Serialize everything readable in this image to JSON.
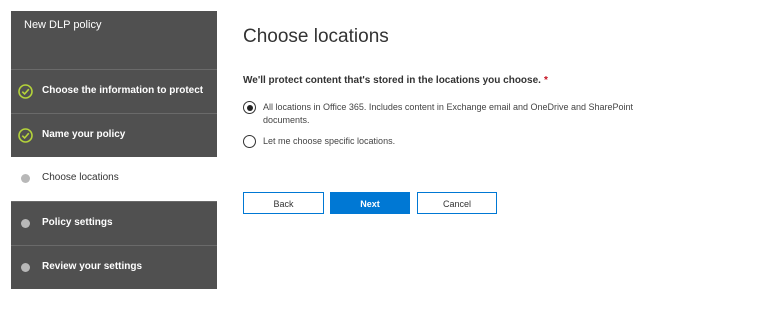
{
  "wizard": {
    "title": "New DLP policy",
    "steps": [
      {
        "label": "Choose the information to protect",
        "state": "completed"
      },
      {
        "label": "Name your policy",
        "state": "completed"
      },
      {
        "label": "Choose locations",
        "state": "current"
      },
      {
        "label": "Policy settings",
        "state": "pending"
      },
      {
        "label": "Review your settings",
        "state": "pending"
      }
    ]
  },
  "main": {
    "title": "Choose locations",
    "question": "We'll protect content that's stored in the locations you choose.",
    "required_mark": "*",
    "options": [
      {
        "label": "All locations in Office 365. Includes content in Exchange email and OneDrive and SharePoint documents.",
        "selected": true
      },
      {
        "label": "Let me choose specific locations.",
        "selected": false
      }
    ]
  },
  "buttons": {
    "back_label": "Back",
    "next_label": "Next",
    "cancel_label": "Cancel"
  },
  "colors": {
    "accent": "#0078d4",
    "sidebar": "#505050",
    "completed_check": "#b4d33a",
    "pending_dot": "#b8b8b8",
    "required": "#c50f1f"
  }
}
